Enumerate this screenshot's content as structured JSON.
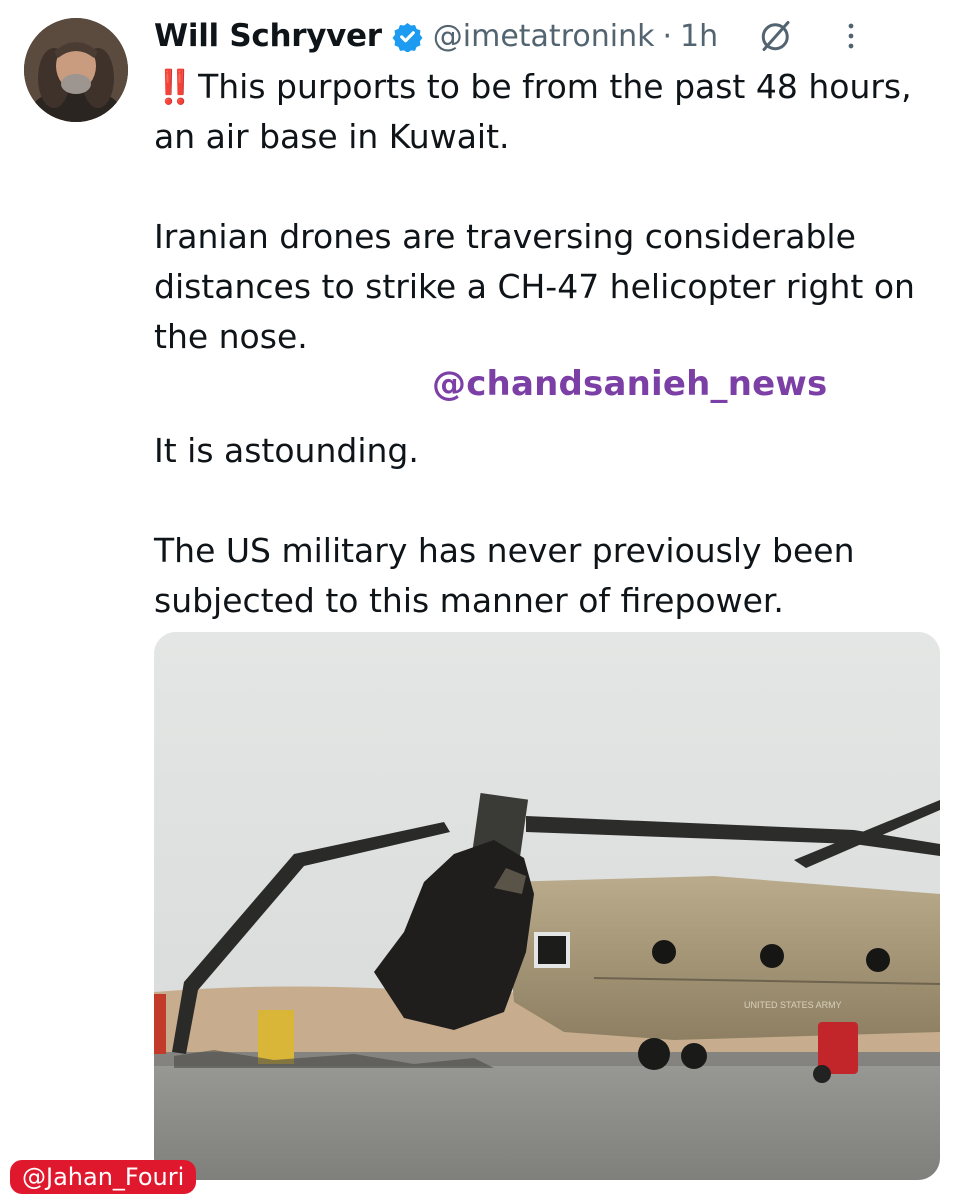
{
  "tweet": {
    "author_name": "Will Schryver",
    "handle": "@imetatronink",
    "separator": "·",
    "time": "1h",
    "emoji_prefix": "‼️",
    "lines": [
      "This purports to be from the past 48 hours, an air base in Kuwait.",
      "Iranian drones are traversing considerable distances to strike a CH-47 helicopter right on the nose.",
      "It is astounding.",
      "The US military has never previously been subjected to this manner of firepower."
    ]
  },
  "watermark": "@chandsanieh_news",
  "credit": "@Jahan_Fouri",
  "photo": {
    "fuselage_label": "UNITED STATES ARMY"
  },
  "icons": {
    "verified": "verified-badge-icon",
    "grok": "grok-icon",
    "more": "more-options-icon"
  },
  "colors": {
    "verified_blue": "#1d9bf0",
    "watermark_purple": "#7b3fa6",
    "credit_red": "#e0182d",
    "secondary_text": "#536471"
  }
}
